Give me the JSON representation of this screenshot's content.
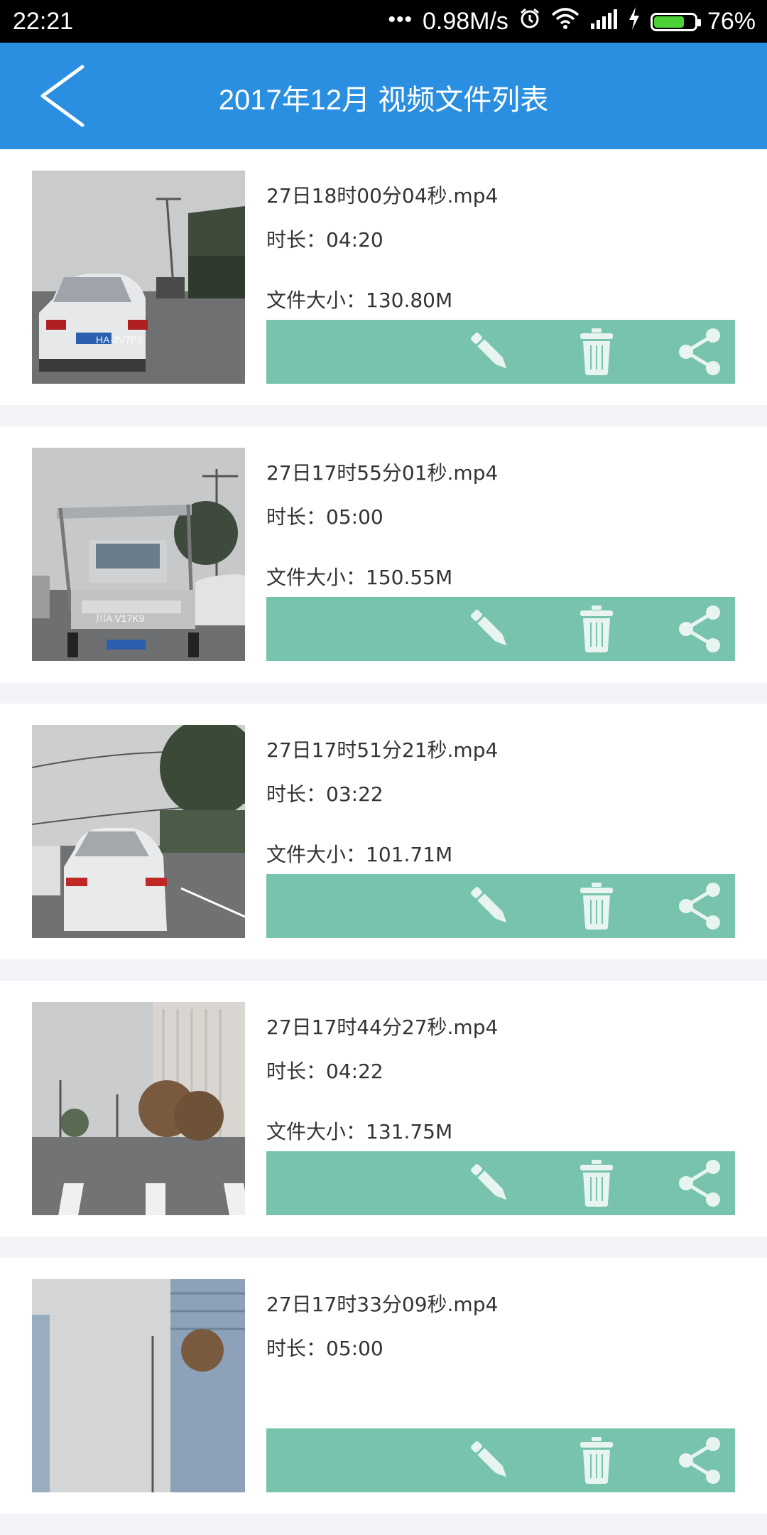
{
  "status_bar": {
    "time": "22:21",
    "network_speed": "0.98M/s",
    "battery_percent": "76%",
    "battery_level": 0.76,
    "icons": [
      "more-dots-icon",
      "alarm-icon",
      "wifi-icon",
      "signal-icon",
      "charging-icon",
      "battery-icon"
    ]
  },
  "header": {
    "title": "2017年12月 视频文件列表",
    "back_icon": "back-arrow-icon"
  },
  "colors": {
    "header_bg": "#2a8fe0",
    "action_bar_bg": "#77c3ad",
    "page_bg": "#f4f4f8"
  },
  "videos": [
    {
      "filename": "27日18时00分04秒.mp4",
      "duration": "时长：04:20",
      "size": "文件大小：130.80M",
      "thumb_plate": "HA·2V7P2"
    },
    {
      "filename": "27日17时55分01秒.mp4",
      "duration": "时长：05:00",
      "size": "文件大小：150.55M",
      "thumb_plate": "川A V17K9"
    },
    {
      "filename": "27日17时51分21秒.mp4",
      "duration": "时长：03:22",
      "size": "文件大小：101.71M",
      "thumb_plate": ""
    },
    {
      "filename": "27日17时44分27秒.mp4",
      "duration": "时长：04:22",
      "size": "文件大小：131.75M",
      "thumb_plate": ""
    },
    {
      "filename": "27日17时33分09秒.mp4",
      "duration": "时长：05:00",
      "size": "",
      "thumb_plate": ""
    }
  ],
  "action_icons": [
    "pencil-icon",
    "trash-icon",
    "share-icon"
  ]
}
